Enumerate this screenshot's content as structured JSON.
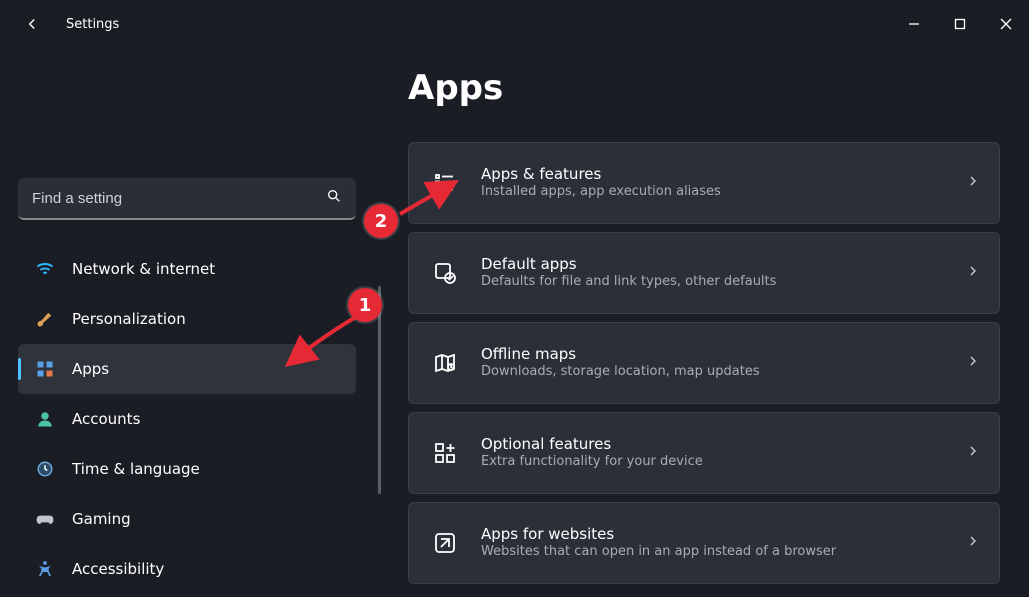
{
  "window": {
    "title": "Settings"
  },
  "search": {
    "placeholder": "Find a setting"
  },
  "nav": {
    "items": [
      {
        "label": "Network & internet",
        "icon": "wifi-icon"
      },
      {
        "label": "Personalization",
        "icon": "brush-icon"
      },
      {
        "label": "Apps",
        "icon": "apps-icon",
        "active": true
      },
      {
        "label": "Accounts",
        "icon": "account-icon"
      },
      {
        "label": "Time & language",
        "icon": "time-icon"
      },
      {
        "label": "Gaming",
        "icon": "gaming-icon"
      },
      {
        "label": "Accessibility",
        "icon": "accessibility-icon"
      }
    ]
  },
  "page": {
    "title": "Apps"
  },
  "cards": [
    {
      "title": "Apps & features",
      "sub": "Installed apps, app execution aliases",
      "icon": "list-icon"
    },
    {
      "title": "Default apps",
      "sub": "Defaults for file and link types, other defaults",
      "icon": "default-apps-icon"
    },
    {
      "title": "Offline maps",
      "sub": "Downloads, storage location, map updates",
      "icon": "map-icon"
    },
    {
      "title": "Optional features",
      "sub": "Extra functionality for your device",
      "icon": "add-feature-icon"
    },
    {
      "title": "Apps for websites",
      "sub": "Websites that can open in an app instead of a browser",
      "icon": "websites-icon"
    }
  ],
  "annotations": {
    "one": "1",
    "two": "2"
  }
}
